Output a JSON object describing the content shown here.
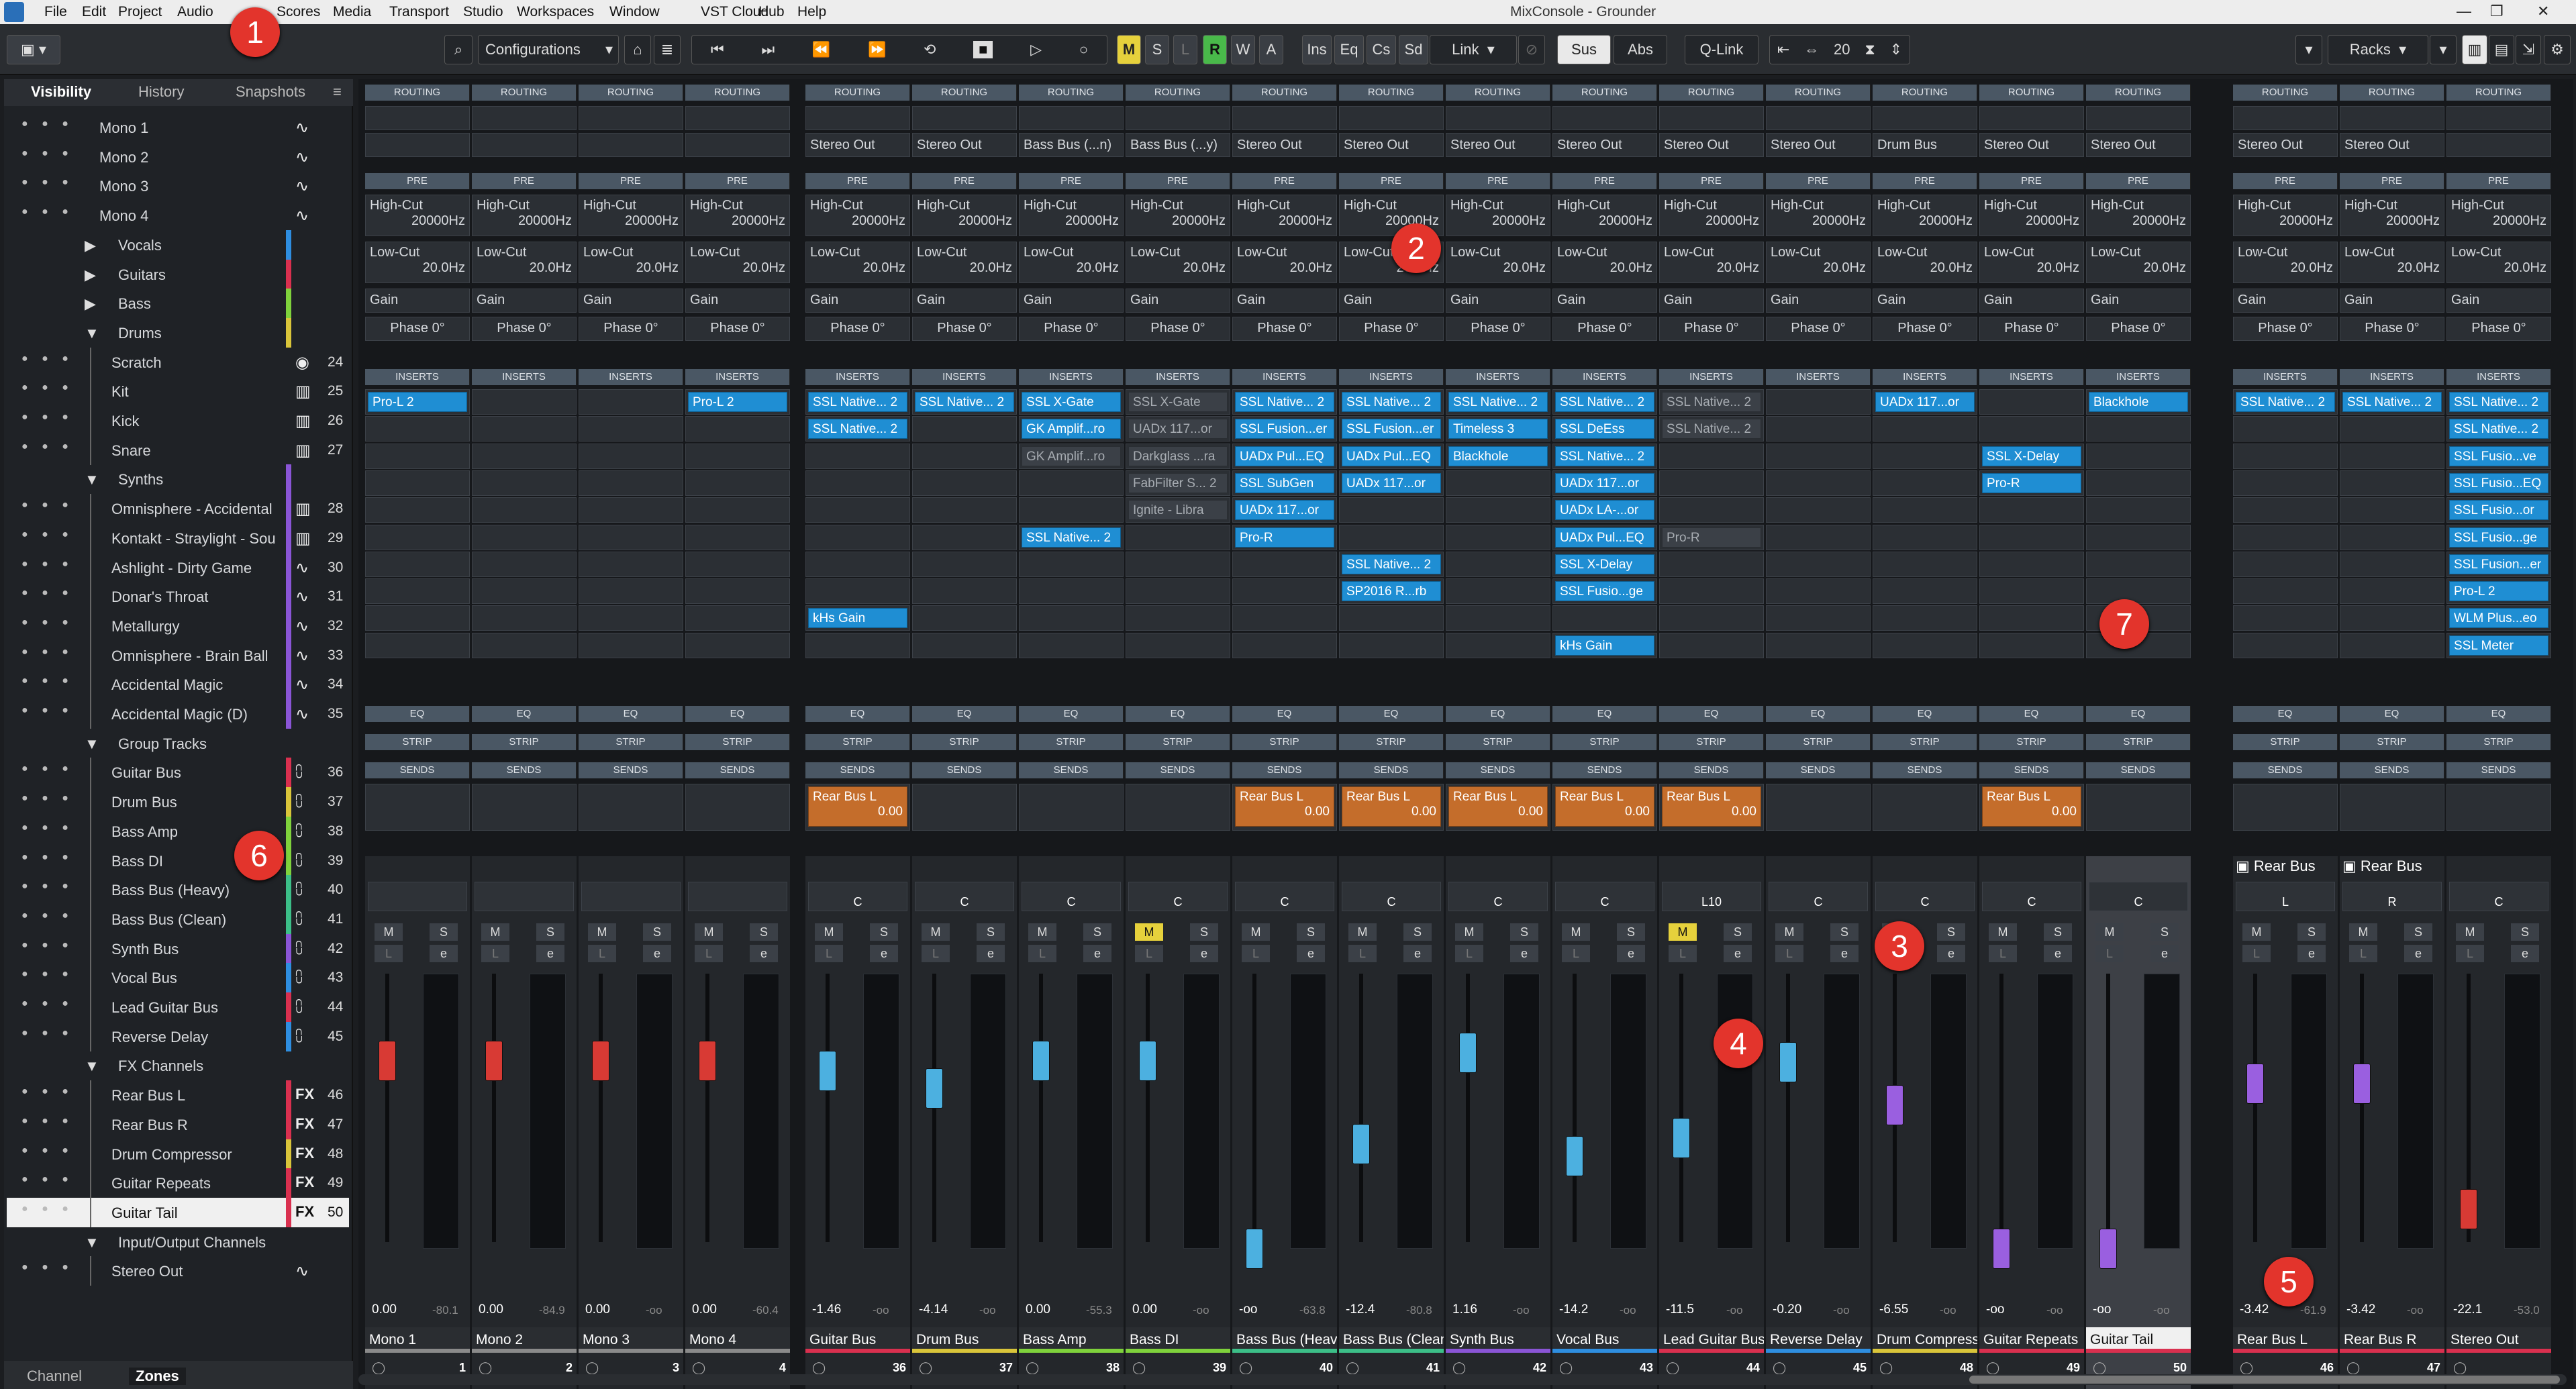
{
  "window": {
    "title": "MixConsole - Grounder"
  },
  "menu": [
    "File",
    "Edit",
    "Project",
    "Audio",
    "Scores",
    "Media",
    "Transport",
    "Studio",
    "Workspaces",
    "Window",
    "VST Cloud",
    "Hub",
    "Help"
  ],
  "toolbar": {
    "configurations": "Configurations",
    "ms_buttons": [
      "M",
      "S",
      "L",
      "R",
      "W",
      "A"
    ],
    "filters": [
      "Ins",
      "Eq",
      "Cs",
      "Sd"
    ],
    "link": "Link",
    "sus": "Sus",
    "abs": "Abs",
    "qlink": "Q-Link",
    "channel_width": "20",
    "racks": "Racks"
  },
  "left_panel": {
    "tabs": [
      "Visibility",
      "History",
      "Snapshots"
    ],
    "bottom_tabs": [
      "Channel",
      "Zones"
    ],
    "rows": [
      {
        "name": "Mono 1",
        "indent": 0,
        "icon": "wave",
        "num": "",
        "color": ""
      },
      {
        "name": "Mono 2",
        "indent": 0,
        "icon": "wave",
        "num": "",
        "color": ""
      },
      {
        "name": "Mono 3",
        "indent": 0,
        "icon": "wave",
        "num": "",
        "color": ""
      },
      {
        "name": "Mono 4",
        "indent": 0,
        "icon": "wave",
        "num": "",
        "color": ""
      },
      {
        "name": "Vocals",
        "indent": 1,
        "icon": "",
        "num": "",
        "color": "#2e8ee0",
        "folder": "closed"
      },
      {
        "name": "Guitars",
        "indent": 1,
        "icon": "",
        "num": "",
        "color": "#d9304f",
        "folder": "closed"
      },
      {
        "name": "Bass",
        "indent": 1,
        "icon": "",
        "num": "",
        "color": "#7fd23c",
        "folder": "closed"
      },
      {
        "name": "Drums",
        "indent": 1,
        "icon": "",
        "num": "",
        "color": "#d9c53a",
        "folder": "open"
      },
      {
        "name": "Scratch",
        "indent": 2,
        "icon": "dial",
        "num": "24",
        "color": ""
      },
      {
        "name": "Kit",
        "indent": 2,
        "icon": "keys",
        "num": "25",
        "color": ""
      },
      {
        "name": "Kick",
        "indent": 2,
        "icon": "keys",
        "num": "26",
        "color": ""
      },
      {
        "name": "Snare",
        "indent": 2,
        "icon": "keys",
        "num": "27",
        "color": ""
      },
      {
        "name": "Synths",
        "indent": 1,
        "icon": "",
        "num": "",
        "color": "#8a55d6",
        "folder": "open"
      },
      {
        "name": "Omnisphere - Accidental",
        "indent": 2,
        "icon": "keys",
        "num": "28",
        "color": "#8a55d6"
      },
      {
        "name": "Kontakt - Straylight - Sou",
        "indent": 2,
        "icon": "keys",
        "num": "29",
        "color": "#8a55d6"
      },
      {
        "name": "Ashlight - Dirty Game",
        "indent": 2,
        "icon": "wave",
        "num": "30",
        "color": "#8a55d6"
      },
      {
        "name": "Donar's Throat",
        "indent": 2,
        "icon": "wave",
        "num": "31",
        "color": "#8a55d6"
      },
      {
        "name": "Metallurgy",
        "indent": 2,
        "icon": "wave",
        "num": "32",
        "color": "#8a55d6"
      },
      {
        "name": "Omnisphere - Brain Ball",
        "indent": 2,
        "icon": "wave",
        "num": "33",
        "color": "#8a55d6"
      },
      {
        "name": "Accidental Magic",
        "indent": 2,
        "icon": "wave",
        "num": "34",
        "color": "#8a55d6"
      },
      {
        "name": "Accidental Magic (D)",
        "indent": 2,
        "icon": "wave",
        "num": "35",
        "color": "#8a55d6"
      },
      {
        "name": "Group Tracks",
        "indent": 1,
        "icon": "",
        "num": "",
        "color": "",
        "folder": "open"
      },
      {
        "name": "Guitar Bus",
        "indent": 2,
        "icon": "group",
        "num": "36",
        "color": "#d9304f"
      },
      {
        "name": "Drum Bus",
        "indent": 2,
        "icon": "group",
        "num": "37",
        "color": "#d9c53a"
      },
      {
        "name": "Bass Amp",
        "indent": 2,
        "icon": "group",
        "num": "38",
        "color": "#7fd23c"
      },
      {
        "name": "Bass DI",
        "indent": 2,
        "icon": "group",
        "num": "39",
        "color": "#7fd23c"
      },
      {
        "name": "Bass Bus (Heavy)",
        "indent": 2,
        "icon": "group",
        "num": "40",
        "color": "#3cbf88"
      },
      {
        "name": "Bass Bus (Clean)",
        "indent": 2,
        "icon": "group",
        "num": "41",
        "color": "#3cbf88"
      },
      {
        "name": "Synth Bus",
        "indent": 2,
        "icon": "group",
        "num": "42",
        "color": "#8a55d6"
      },
      {
        "name": "Vocal Bus",
        "indent": 2,
        "icon": "group",
        "num": "43",
        "color": "#2e8ee0"
      },
      {
        "name": "Lead Guitar Bus",
        "indent": 2,
        "icon": "group",
        "num": "44",
        "color": "#d9304f"
      },
      {
        "name": "Reverse Delay",
        "indent": 2,
        "icon": "group",
        "num": "45",
        "color": "#2e8ee0"
      },
      {
        "name": "FX Channels",
        "indent": 1,
        "icon": "",
        "num": "",
        "color": "",
        "folder": "open"
      },
      {
        "name": "Rear Bus L",
        "indent": 2,
        "icon": "fx",
        "num": "46",
        "color": "#d9304f"
      },
      {
        "name": "Rear Bus R",
        "indent": 2,
        "icon": "fx",
        "num": "47",
        "color": "#d9304f"
      },
      {
        "name": "Drum Compressor",
        "indent": 2,
        "icon": "fx",
        "num": "48",
        "color": "#d9c53a"
      },
      {
        "name": "Guitar Repeats",
        "indent": 2,
        "icon": "fx",
        "num": "49",
        "color": "#d9304f"
      },
      {
        "name": "Guitar Tail",
        "indent": 2,
        "icon": "fx",
        "num": "50",
        "color": "#d9304f",
        "selected": true
      },
      {
        "name": "Input/Output Channels",
        "indent": 1,
        "icon": "",
        "num": "",
        "color": "",
        "folder": "open"
      },
      {
        "name": "Stereo Out",
        "indent": 2,
        "icon": "wave",
        "num": "",
        "color": ""
      }
    ]
  },
  "section_labels": {
    "routing": "ROUTING",
    "pre": "PRE",
    "inserts": "INSERTS",
    "eq": "EQ",
    "strip": "STRIP",
    "sends": "SENDS"
  },
  "pre_labels": {
    "highcut": "High-Cut",
    "highcut_val": "20000Hz",
    "lowcut": "Low-Cut",
    "lowcut_val": "20.0Hz",
    "gain": "Gain",
    "phase": "Phase 0°"
  },
  "send_defaults": {
    "value": "0.00"
  },
  "channels": [
    {
      "name": "Mono 1",
      "num": "1",
      "color": "#8a8a8a",
      "routing": "",
      "fader": "red",
      "vol": "0.00",
      "peak": "-80.1",
      "pan": "",
      "inserts": [
        "",
        "Pro-L 2"
      ]
    },
    {
      "name": "Mono 2",
      "num": "2",
      "color": "#8a8a8a",
      "routing": "",
      "fader": "red",
      "vol": "0.00",
      "peak": "-84.9",
      "pan": "",
      "inserts": []
    },
    {
      "name": "Mono 3",
      "num": "3",
      "color": "#8a8a8a",
      "routing": "",
      "fader": "red",
      "vol": "0.00",
      "peak": "-oo",
      "pan": "",
      "inserts": []
    },
    {
      "name": "Mono 4",
      "num": "4",
      "color": "#8a8a8a",
      "routing": "",
      "fader": "red",
      "vol": "0.00",
      "peak": "-60.4",
      "pan": "",
      "inserts": [
        "",
        "Pro-L 2"
      ]
    },
    {
      "name": "Guitar Bus",
      "num": "36",
      "color": "#d9304f",
      "routing": "Stereo Out",
      "fader": "blue",
      "vol": "-1.46",
      "peak": "-oo",
      "pan": "C",
      "inserts": [
        "",
        "SSL Native... 2",
        "SSL Native... 2",
        "",
        "",
        "",
        "",
        "",
        "",
        "kHs Gain"
      ],
      "send": "Rear Bus L"
    },
    {
      "name": "Drum Bus",
      "num": "37",
      "color": "#d9c53a",
      "routing": "Stereo Out",
      "fader": "blue",
      "vol": "-4.14",
      "peak": "-oo",
      "pan": "C",
      "inserts": [
        "",
        "SSL Native... 2"
      ]
    },
    {
      "name": "Bass Amp",
      "num": "38",
      "color": "#7fd23c",
      "routing": "Bass Bus (...n)",
      "fader": "blue",
      "vol": "0.00",
      "peak": "-55.3",
      "pan": "C",
      "inserts": [
        "",
        "SSL X-Gate",
        "GK Amplif...ro",
        "GK Amplif...ro",
        "",
        "",
        "SSL Native... 2"
      ]
    },
    {
      "name": "Bass DI",
      "num": "39",
      "color": "#7fd23c",
      "routing": "Bass Bus (...y)",
      "fader": "blue",
      "vol": "0.00",
      "peak": "-oo",
      "pan": "C",
      "inserts": [
        "",
        "SSL X-Gate",
        "UADx 117...or",
        "Darkglass ...ra",
        "FabFilter S... 2",
        "Ignite - Libra"
      ],
      "mute": true
    },
    {
      "name": "Bass Bus (Heavy)",
      "num": "40",
      "color": "#3cbf88",
      "routing": "Stereo Out",
      "fader": "blue",
      "vol": "-oo",
      "peak": "-63.8",
      "pan": "C",
      "inserts": [
        "",
        "SSL Native... 2",
        "SSL Fusion...er",
        "UADx Pul...EQ",
        "SSL SubGen",
        "UADx 117...or",
        "Pro-R"
      ],
      "send": "Rear Bus L"
    },
    {
      "name": "Bass Bus (Clean)",
      "num": "41",
      "color": "#3cbf88",
      "routing": "Stereo Out",
      "fader": "blue",
      "vol": "-12.4",
      "peak": "-80.8",
      "pan": "C",
      "inserts": [
        "",
        "SSL Native... 2",
        "SSL Fusion...er",
        "UADx Pul...EQ",
        "UADx 117...or",
        "",
        "",
        "SSL Native... 2",
        "SP2016 R...rb"
      ],
      "send": "Rear Bus L"
    },
    {
      "name": "Synth Bus",
      "num": "42",
      "color": "#8a55d6",
      "routing": "Stereo Out",
      "fader": "blue",
      "vol": "1.16",
      "peak": "-oo",
      "pan": "C",
      "inserts": [
        "",
        "SSL Native... 2",
        "Timeless 3",
        "Blackhole"
      ],
      "send": "Rear Bus L"
    },
    {
      "name": "Vocal Bus",
      "num": "43",
      "color": "#2e8ee0",
      "routing": "Stereo Out",
      "fader": "blue",
      "vol": "-14.2",
      "peak": "-oo",
      "pan": "C",
      "inserts": [
        "",
        "SSL Native... 2",
        "SSL DeEss",
        "SSL Native... 2",
        "UADx 117...or",
        "UADx LA-...or",
        "UADx Pul...EQ",
        "SSL X-Delay",
        "SSL Fusio...ge",
        "",
        "kHs Gain"
      ],
      "send": "Rear Bus L"
    },
    {
      "name": "Lead Guitar Bus",
      "num": "44",
      "color": "#d9304f",
      "routing": "Stereo Out",
      "fader": "blue",
      "vol": "-11.5",
      "peak": "-oo",
      "pan": "L10",
      "inserts": [
        "",
        "SSL Native... 2",
        "SSL Native... 2",
        "",
        "",
        "",
        "Pro-R"
      ],
      "send": "Rear Bus L",
      "mute": true
    },
    {
      "name": "Reverse Delay",
      "num": "45",
      "color": "#2e8ee0",
      "routing": "Stereo Out",
      "fader": "blue",
      "vol": "-0.20",
      "peak": "-oo",
      "pan": "C",
      "inserts": []
    },
    {
      "name": "Drum Compressor",
      "num": "48",
      "color": "#d9c53a",
      "routing": "Drum Bus",
      "fader": "purple",
      "vol": "-6.55",
      "peak": "-oo",
      "pan": "C",
      "inserts": [
        "",
        "UADx 117...or"
      ]
    },
    {
      "name": "Guitar Repeats",
      "num": "49",
      "color": "#d9304f",
      "routing": "Stereo Out",
      "fader": "purple",
      "vol": "-oo",
      "peak": "-oo",
      "pan": "C",
      "inserts": [
        "",
        "",
        "",
        "SSL X-Delay",
        "Pro-R"
      ],
      "send": "Rear Bus L"
    },
    {
      "name": "Guitar Tail",
      "num": "50",
      "color": "#d9304f",
      "routing": "Stereo Out",
      "fader": "purple",
      "vol": "-oo",
      "peak": "-oo",
      "pan": "C",
      "inserts": [
        "",
        "Blackhole"
      ],
      "selected": true
    },
    {
      "name": "Rear Bus L",
      "num": "46",
      "color": "#d9304f",
      "routing": "Stereo Out",
      "fader": "purple",
      "vol": "-3.42",
      "peak": "-61.9",
      "pan": "L",
      "inserts": [
        "",
        "SSL Native... 2"
      ],
      "rearbus": "Rear Bus"
    },
    {
      "name": "Rear Bus R",
      "num": "47",
      "color": "#d9304f",
      "routing": "Stereo Out",
      "fader": "purple",
      "vol": "-3.42",
      "peak": "-oo",
      "pan": "R",
      "inserts": [
        "",
        "SSL Native... 2"
      ],
      "rearbus": "Rear Bus"
    },
    {
      "name": "Stereo Out",
      "num": "",
      "color": "#d9304f",
      "routing": "",
      "fader": "red",
      "vol": "-22.1",
      "peak": "-53.0",
      "pan": "C",
      "inserts": [
        "",
        "SSL Native... 2",
        "SSL Native... 2",
        "SSL Fusio...ve",
        "SSL Fusio...EQ",
        "SSL Fusio...or",
        "SSL Fusio...ge",
        "SSL Fusion...er",
        "Pro-L 2",
        "WLM Plus...eo",
        "SSL Meter"
      ]
    }
  ],
  "badges": [
    "1",
    "2",
    "3",
    "4",
    "5",
    "6",
    "7"
  ]
}
